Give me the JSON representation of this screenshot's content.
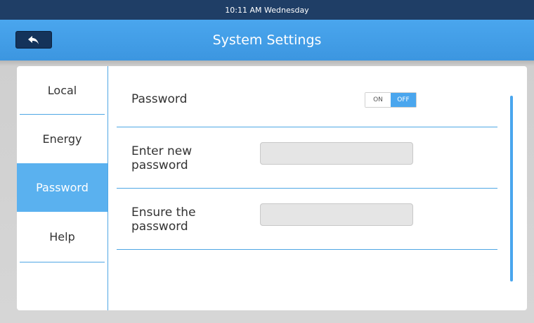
{
  "status_bar": {
    "datetime": "10:11 AM Wednesday"
  },
  "header": {
    "title": "System Settings",
    "back_icon": "back-arrow-icon"
  },
  "sidebar": {
    "items": [
      {
        "label": "Local",
        "active": false
      },
      {
        "label": "Energy",
        "active": false
      },
      {
        "label": "Password",
        "active": true
      },
      {
        "label": "Help",
        "active": false
      }
    ]
  },
  "password_toggle": {
    "label": "Password",
    "on_label": "ON",
    "off_label": "OFF",
    "selected": "OFF"
  },
  "new_password": {
    "label_line1": "Enter new",
    "label_line2": "password",
    "value": "",
    "placeholder": ""
  },
  "confirm_password": {
    "label_line1": "Ensure the",
    "label_line2": "password",
    "value": "",
    "placeholder": ""
  },
  "colors": {
    "status_bar": "#1f3e66",
    "header": "#4aa6ee",
    "accent": "#4aa6ee",
    "active_item": "#5ab1ef",
    "back_button": "#14335a"
  }
}
